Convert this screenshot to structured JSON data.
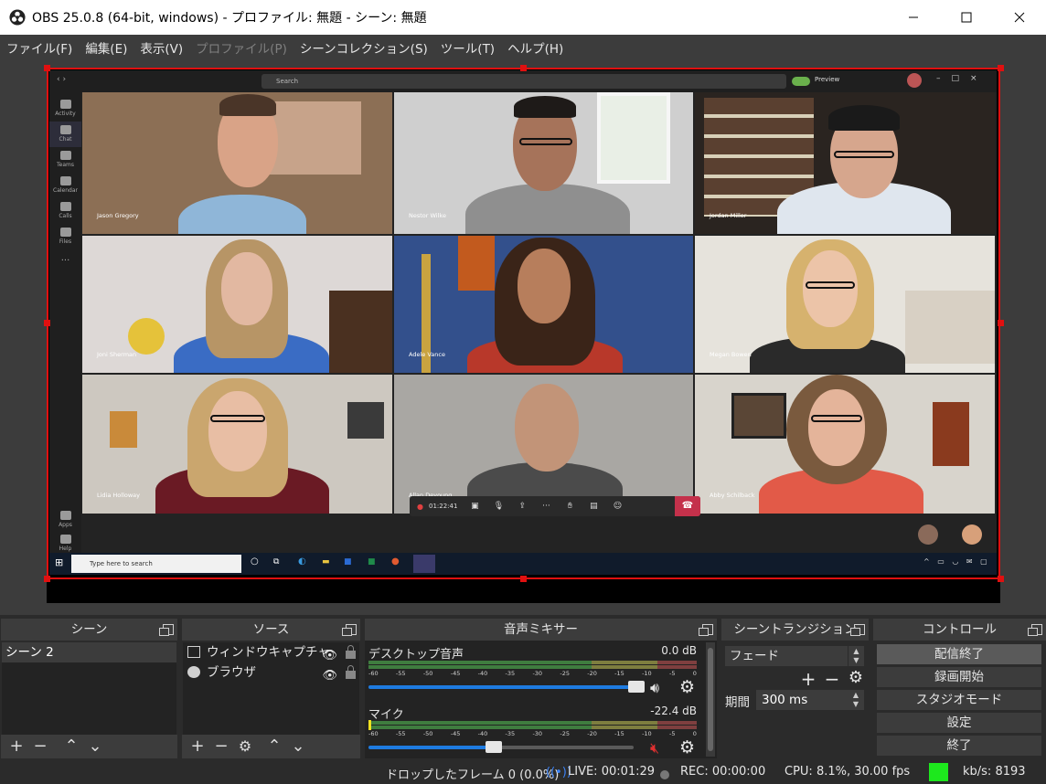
{
  "window": {
    "title": "OBS 25.0.8 (64-bit, windows) - プロファイル: 無題 - シーン: 無題",
    "min_icon": "minimize-icon",
    "max_icon": "maximize-icon",
    "close_icon": "close-icon"
  },
  "menu": [
    {
      "label": "ファイル(F)",
      "disabled": false
    },
    {
      "label": "編集(E)",
      "disabled": false
    },
    {
      "label": "表示(V)",
      "disabled": false
    },
    {
      "label": "プロファイル(P)",
      "disabled": true
    },
    {
      "label": "シーンコレクション(S)",
      "disabled": false
    },
    {
      "label": "ツール(T)",
      "disabled": false
    },
    {
      "label": "ヘルプ(H)",
      "disabled": false
    }
  ],
  "preview": {
    "teams_search": "Search",
    "teams_preview_label": "Preview",
    "rail": [
      "Activity",
      "Chat",
      "Teams",
      "Calendar",
      "Calls",
      "Files",
      "..."
    ],
    "rail_bottom": [
      "Apps",
      "Help"
    ],
    "call_timer": "01:22:41",
    "taskbar_search": "Type here to search",
    "participants": [
      {
        "name": "Jason Gregory"
      },
      {
        "name": "Nestor Wilke"
      },
      {
        "name": "Jordan Miller"
      },
      {
        "name": "Joni Sherman"
      },
      {
        "name": "Adele Vance"
      },
      {
        "name": "Megan Bowen"
      },
      {
        "name": "Lidia Holloway"
      },
      {
        "name": "Allan Deyoung"
      },
      {
        "name": "Abby Schilback"
      }
    ]
  },
  "docks": {
    "scenes": {
      "title": "シーン",
      "items": [
        "シーン 2"
      ]
    },
    "sources": {
      "title": "ソース",
      "items": [
        {
          "label": "ウィンドウキャプチャ",
          "icon": "window-icon"
        },
        {
          "label": "ブラウザ",
          "icon": "globe-icon"
        }
      ]
    },
    "mixer": {
      "title": "音声ミキサー",
      "ticks": [
        "-60",
        "-55",
        "-50",
        "-45",
        "-40",
        "-35",
        "-30",
        "-25",
        "-20",
        "-15",
        "-10",
        "-5",
        "0"
      ],
      "channels": [
        {
          "name": "デスクトップ音声",
          "db": "0.0 dB",
          "level": 1.0,
          "muted": false
        },
        {
          "name": "マイク",
          "db": "-22.4 dB",
          "level": 0.45,
          "muted": true
        }
      ]
    },
    "transitions": {
      "title": "シーントランジション",
      "selected": "フェード",
      "duration_label": "期間",
      "duration_value": "300 ms"
    },
    "controls": {
      "title": "コントロール",
      "buttons": [
        "配信終了",
        "録画開始",
        "スタジオモード",
        "設定",
        "終了"
      ]
    }
  },
  "status": {
    "dropped": "ドロップしたフレーム 0 (0.0%)",
    "live": "LIVE: 00:01:29",
    "rec": "REC: 00:00:00",
    "cpu": "CPU: 8.1%, 30.00 fps",
    "kbps": "kb/s: 8193",
    "indicator_color": "#1de81d"
  }
}
